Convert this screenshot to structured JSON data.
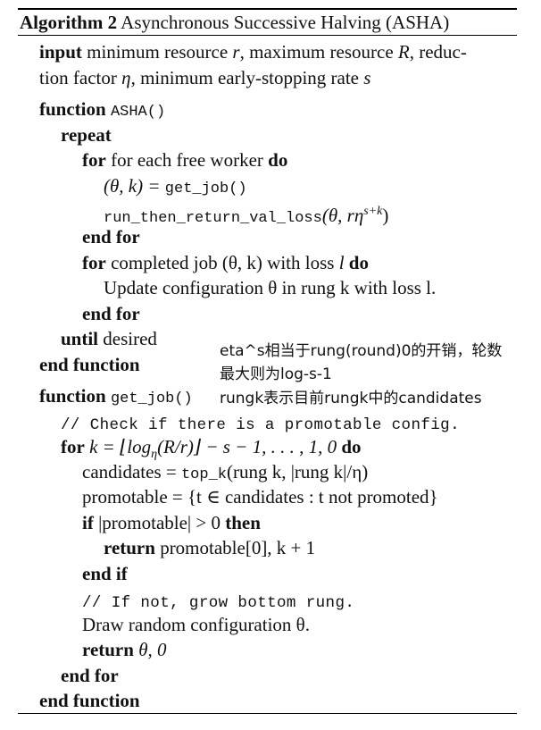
{
  "header": {
    "label": "Algorithm 2",
    "title": "Asynchronous Successive Halving (ASHA)"
  },
  "input": {
    "kw": "input",
    "line1": "minimum resource",
    "r": "r",
    "line1b": ", maximum resource",
    "R": "R",
    "line1c": ", reduc-",
    "line2": "tion factor",
    "eta": "η",
    "line2b": ", minimum early-stopping rate",
    "s": "s"
  },
  "asha": {
    "function_kw": "function",
    "name": "ASHA()",
    "repeat_kw": "repeat",
    "for_kw": "for",
    "for1_text": "for each free worker",
    "do_kw": "do",
    "assign_lhs": "(θ, k) = ",
    "assign_fn": "get_job()",
    "run_fn": "run_then_return_val_loss",
    "run_args": "(θ, rη",
    "run_sup": "s+k",
    "run_close": ")",
    "endfor_kw": "end for",
    "for2_text": "completed job (θ, k) with loss",
    "l": "l",
    "update_text": "Update configuration θ in rung k with loss l.",
    "until_kw": "until",
    "until_text": "desired",
    "endfunction_kw": "end function"
  },
  "getjob": {
    "function_kw": "function",
    "name": "get_job()",
    "comment1": "// Check if there is a promotable config.",
    "for_kw": "for",
    "for_expr": "k = ⌊log",
    "for_sub": "η",
    "for_expr2": "(R/r)⌋ − s − 1, . . . , 1, 0",
    "do_kw": "do",
    "cand_lhs": "candidates = ",
    "cand_fn": "top_k",
    "cand_args": "(rung k, |rung k|/η)",
    "prom_text": "promotable = {t ∈ candidates : t not promoted}",
    "if_kw": "if",
    "if_text": "|promotable| > 0",
    "then_kw": "then",
    "return_kw": "return",
    "return1_text": "promotable[0], k + 1",
    "endif_kw": "end if",
    "comment2": "// If not, grow bottom rung.",
    "draw_text": "Draw random configuration θ.",
    "return2_text": "θ, 0",
    "endfor_kw": "end for",
    "endfunction_kw": "end function"
  },
  "annotation": {
    "line1": "eta^s相当于rung(round)0的开销，轮数",
    "line2": "最大则为log-s-1",
    "line3": "rungk表示目前rungk中的candidates"
  }
}
